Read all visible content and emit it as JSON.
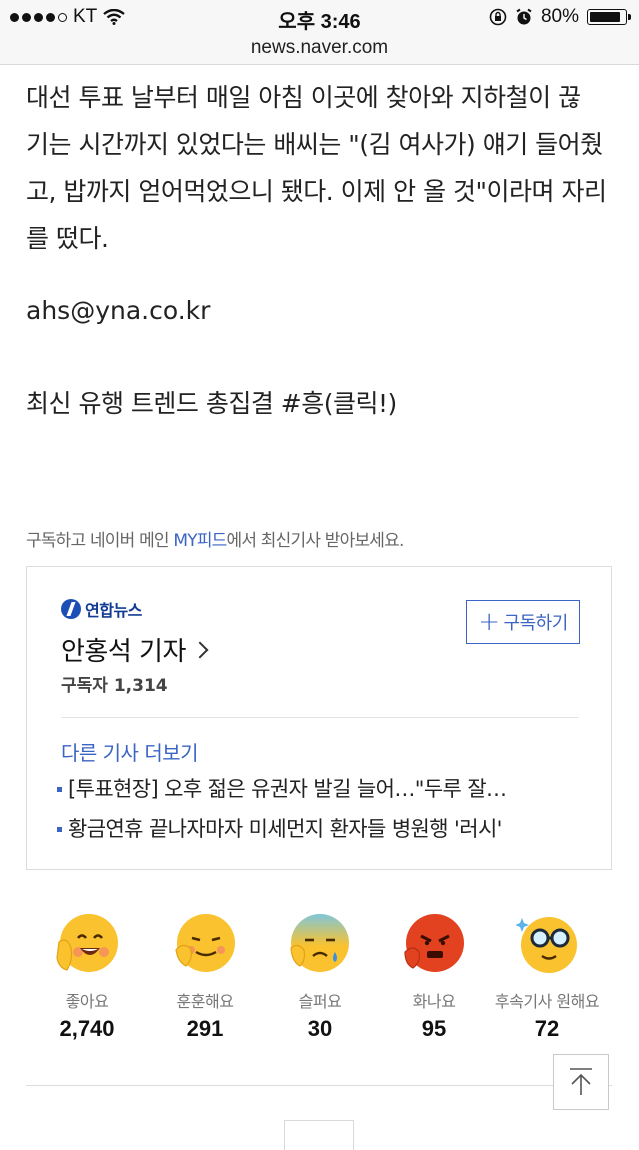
{
  "status_bar": {
    "carrier": "KT",
    "time": "오후 3:46",
    "battery": "80%",
    "battery_level": 0.8
  },
  "browser": {
    "url": "news.naver.com"
  },
  "article": {
    "paragraph_lines": [
      "대선 투표 날부터 매일 아침 이곳에 찾아와 지하철이 끊",
      "기는 시간까지 있었다는 배씨는 \"(김 여사가) 얘기 들어줬",
      "고, 밥까지 얻어먹었으니 됐다. 이제 안 올 것\"이라며 자리",
      "를 떴다."
    ],
    "email": "ahs@yna.co.kr",
    "trend_link": "최신 유행 트렌드 총집결 #흥(클릭!)"
  },
  "subscribe_note": {
    "prefix": "구독하고 네이버 메인 ",
    "highlight": "MY피드",
    "suffix": "에서 최신기사 받아보세요."
  },
  "reporter_card": {
    "press_name": "연합뉴스",
    "reporter_name": "안홍석 기자",
    "subscribers": "구독자 1,314",
    "subscribe_button": "구독하기",
    "more_articles": "다른 기사 더보기",
    "articles": [
      "[투표현장] 오후 젊은 유권자 발길 늘어…\"두루 잘…",
      "황금연휴 끝나자마자 미세먼지 환자들 병원행 '러시'"
    ]
  },
  "reactions": [
    {
      "label": "좋아요",
      "count": "2,740",
      "icon": "like-face-icon"
    },
    {
      "label": "훈훈해요",
      "count": "291",
      "icon": "warm-face-icon"
    },
    {
      "label": "슬퍼요",
      "count": "30",
      "icon": "sad-face-icon"
    },
    {
      "label": "화나요",
      "count": "95",
      "icon": "angry-face-icon"
    },
    {
      "label": "후속기사 원해요",
      "count": "72",
      "icon": "glasses-face-icon"
    }
  ],
  "colors": {
    "accent_blue": "#3b64c4",
    "press_blue": "#123c92",
    "emoji_yellow": "#f9c22e",
    "emoji_red": "#e2421f"
  }
}
